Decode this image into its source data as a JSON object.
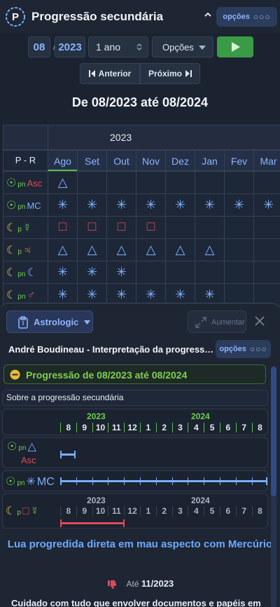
{
  "header": {
    "title": "Progressão secundária",
    "options_label": "opções"
  },
  "controls": {
    "month": "08",
    "separator": "/",
    "year": "2023",
    "period": "1 ano",
    "options_select": "Opções",
    "prev_label": "Anterior",
    "next_label": "Próximo"
  },
  "range_title": "De 08/2023 até 08/2024",
  "grid": {
    "year_label": "2023",
    "corner_label": "P - R",
    "months": [
      "Ago",
      "Set",
      "Out",
      "Nov",
      "Dez",
      "Jan",
      "Fev",
      "Mar"
    ],
    "rows": [
      {
        "label_parts": [
          "☉",
          "pn",
          "Asc"
        ],
        "colors": [
          "#6fd04b",
          "#6fd04b",
          "#e04a58"
        ],
        "symbols": [
          "△",
          "",
          "",
          "",
          "",
          "",
          "",
          ""
        ],
        "color": "#7ab0ff"
      },
      {
        "label_parts": [
          "☉",
          "pn",
          "MC"
        ],
        "colors": [
          "#6fd04b",
          "#6fd04b",
          "#7ab0ff"
        ],
        "symbols": [
          "✳",
          "✳",
          "✳",
          "✳",
          "✳",
          "✳",
          "✳",
          "✳"
        ],
        "color": "#7ab0ff"
      },
      {
        "label_parts": [
          "☾",
          "p",
          "☿"
        ],
        "colors": [
          "#f0c040",
          "#6fd04b",
          "#6fd04b"
        ],
        "symbols": [
          "□",
          "□",
          "□",
          "□",
          "",
          "",
          "",
          ""
        ],
        "color": "#e04a58"
      },
      {
        "label_parts": [
          "☾",
          "p",
          "♃"
        ],
        "colors": [
          "#f0c040",
          "#6fd04b",
          "#f08a30"
        ],
        "symbols": [
          "△",
          "△",
          "△",
          "△",
          "△",
          "△",
          "",
          ""
        ],
        "color": "#7ab0ff"
      },
      {
        "label_parts": [
          "☾",
          "pn",
          "☾"
        ],
        "colors": [
          "#f0c040",
          "#6fd04b",
          "#7ab0ff"
        ],
        "symbols": [
          "✳",
          "✳",
          "✳",
          "",
          "",
          "",
          "",
          ""
        ],
        "color": "#7ab0ff"
      },
      {
        "label_parts": [
          "☾",
          "pn",
          "♂"
        ],
        "colors": [
          "#f0c040",
          "#6fd04b",
          "#e04a58"
        ],
        "symbols": [
          "✳",
          "✳",
          "✳",
          "✳",
          "✳",
          "✳",
          "",
          ""
        ],
        "color": "#7ab0ff"
      }
    ]
  },
  "panel": {
    "source_label": "Astrologic",
    "expand_label": "Aumentar",
    "subtitle": "André Boudineau - Interpretação da progressão secundária",
    "options_label": "opções",
    "progress_label": "Progressão de 08/2023 até 08/2024",
    "about_label": "Sobre a progressão secundária",
    "year_a": "2023",
    "year_b": "2024",
    "months_a": [
      "8",
      "9",
      "10",
      "11",
      "12"
    ],
    "months_b": [
      "1",
      "2",
      "3",
      "4",
      "5",
      "6",
      "7",
      "8"
    ],
    "timelines": [
      {
        "planet": "☉",
        "sub": "pn",
        "aspect": "△",
        "target": "Asc"
      },
      {
        "planet": "☉",
        "sub": "pn",
        "aspect": "✳",
        "target": "MC"
      },
      {
        "planet": "☾",
        "sub": "p",
        "aspect": "□",
        "target": "☿"
      }
    ],
    "heading": "Lua progredida direta em mau aspecto com Mercúrio",
    "until_prefix": "Até",
    "until_date": "11/2023",
    "body_text": "Cuidado com tudo que envolver documentos e papéis em"
  },
  "colors": {
    "green": "#3a9b46",
    "accent_blue": "#8ab4ff",
    "aspect_red": "#e04a58"
  }
}
